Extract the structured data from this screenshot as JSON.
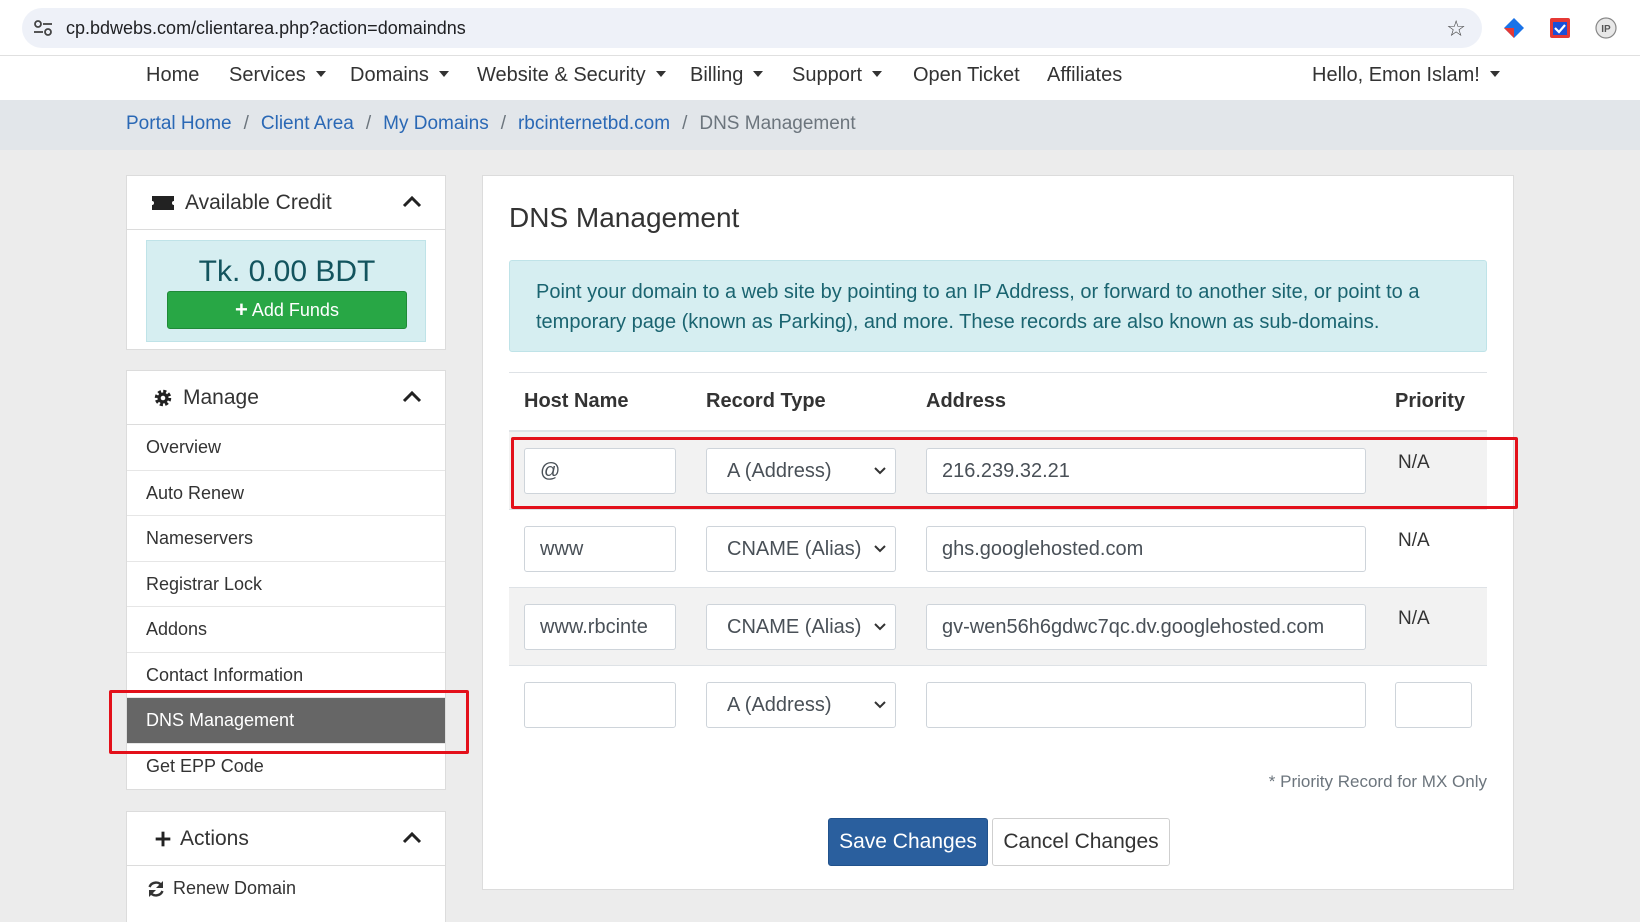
{
  "browser": {
    "url": "cp.bdwebs.com/clientarea.php?action=domaindns"
  },
  "nav": {
    "items": [
      "Home",
      "Services",
      "Domains",
      "Website & Security",
      "Billing",
      "Support",
      "Open Ticket",
      "Affiliates"
    ],
    "user": "Hello, Emon Islam!"
  },
  "breadcrumb": {
    "items": [
      "Portal Home",
      "Client Area",
      "My Domains",
      "rbcinternetbd.com"
    ],
    "separator": "/",
    "current": "DNS Management"
  },
  "sidebar": {
    "credit": {
      "title": "Available Credit",
      "amount": "Tk. 0.00 BDT",
      "button": "Add Funds"
    },
    "manage": {
      "title": "Manage",
      "items": [
        "Overview",
        "Auto Renew",
        "Nameservers",
        "Registrar Lock",
        "Addons",
        "Contact Information",
        "DNS Management",
        "Get EPP Code"
      ],
      "active": "DNS Management"
    },
    "actions": {
      "title": "Actions",
      "items": [
        "Renew Domain"
      ]
    }
  },
  "main": {
    "title": "DNS Management",
    "info": "Point your domain to a web site by pointing to an IP Address, or forward to another site, or point to a temporary page (known as Parking), and more. These records are also known as sub-domains.",
    "table": {
      "headers": [
        "Host Name",
        "Record Type",
        "Address",
        "Priority"
      ],
      "rows": [
        {
          "host": "@",
          "type": "A (Address)",
          "address": "216.239.32.21",
          "priority": "N/A"
        },
        {
          "host": "www",
          "type": "CNAME (Alias)",
          "address": "ghs.googlehosted.com",
          "priority": "N/A"
        },
        {
          "host": "www.rbcinte",
          "type": "CNAME (Alias)",
          "address": "gv-wen56h6gdwc7qc.dv.googlehosted.com",
          "priority": "N/A"
        },
        {
          "host": "",
          "type": "A (Address)",
          "address": "",
          "priority": ""
        }
      ]
    },
    "note": "* Priority Record for MX Only",
    "save": "Save Changes",
    "cancel": "Cancel Changes"
  },
  "colors": {
    "accent": "#2a5f9e",
    "link": "#2a68b5",
    "success": "#28a745",
    "highlight": "#e3101a",
    "active_menu": "#666666",
    "info_bg": "#d6eef1"
  }
}
